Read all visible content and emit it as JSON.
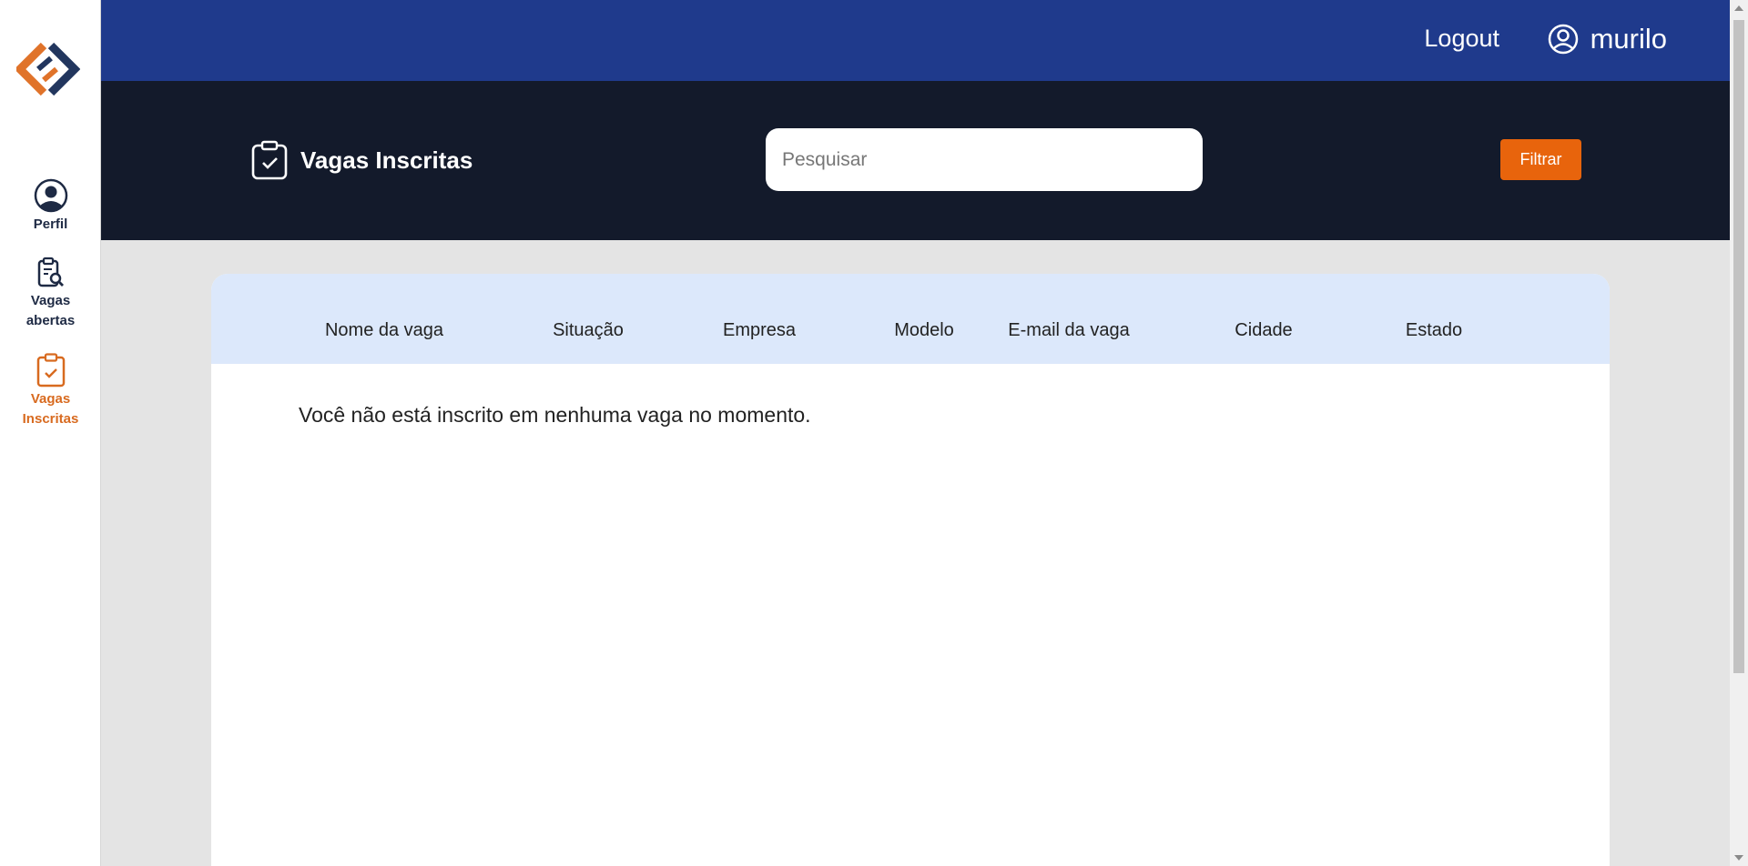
{
  "sidebar": {
    "items": [
      {
        "label": "Perfil",
        "icon": "user-circle-icon"
      },
      {
        "label": "Vagas\nabertas",
        "icon": "clipboard-search-icon"
      },
      {
        "label": "Vagas\nInscritas",
        "icon": "clipboard-check-icon",
        "active": true
      }
    ]
  },
  "topbar": {
    "logout_label": "Logout",
    "username": "murilo"
  },
  "header": {
    "title": "Vagas Inscritas",
    "search_placeholder": "Pesquisar",
    "search_value": "",
    "filter_label": "Filtrar"
  },
  "table": {
    "columns": [
      "Nome da vaga",
      "Situação",
      "Empresa",
      "Modelo",
      "E-mail da vaga",
      "Cidade",
      "Estado"
    ],
    "rows": [],
    "empty_message": "Você não está inscrito em nenhuma vaga no momento."
  },
  "colors": {
    "topbar": "#1f3a8c",
    "header": "#131a2b",
    "accent": "#e8640c",
    "active_nav": "#d86a1f",
    "table_header": "#dce8fb"
  }
}
